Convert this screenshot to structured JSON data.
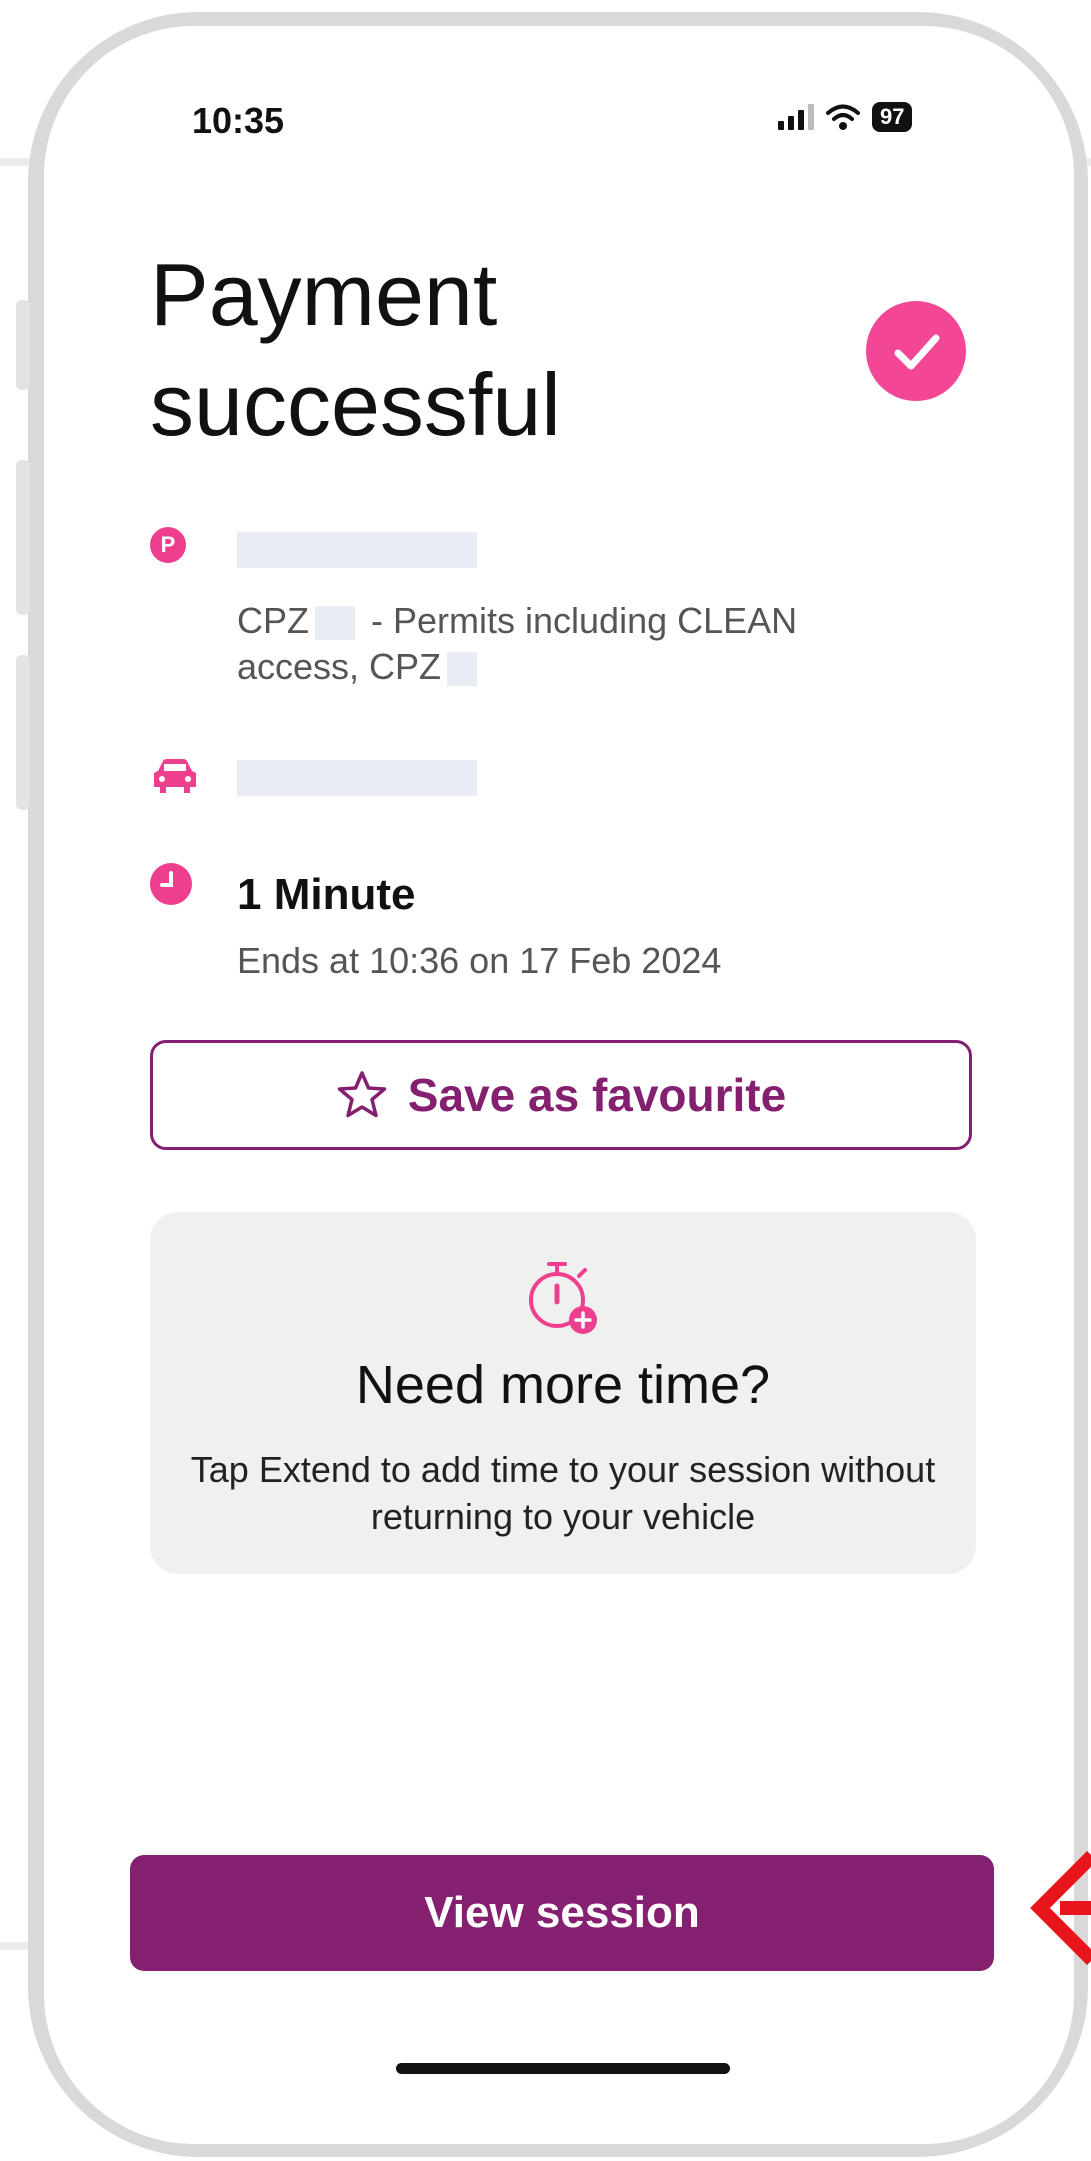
{
  "status_bar": {
    "time": "10:35",
    "battery": "97"
  },
  "header": {
    "title": "Payment successful"
  },
  "location": {
    "subtitle_part1": "CPZ",
    "subtitle_part2": " - Permits including CLEAN access, CPZ"
  },
  "duration": {
    "label": "1 Minute",
    "ends_text": "Ends at 10:36 on 17 Feb 2024"
  },
  "buttons": {
    "favourite_label": "Save as favourite",
    "view_session_label": "View session"
  },
  "extend_card": {
    "title": "Need more time?",
    "text": "Tap Extend to add time to your session without returning to your vehicle"
  },
  "icons": {
    "parking": "parking-pin-icon",
    "vehicle": "car-icon",
    "clock": "clock-icon",
    "star": "star-outline-icon",
    "timer_add": "stopwatch-plus-icon"
  },
  "colors": {
    "accent_pink": "#f34796",
    "primary_purple": "#852070",
    "card_bg": "#f0f0f0",
    "annotation_red": "#e8151b"
  }
}
